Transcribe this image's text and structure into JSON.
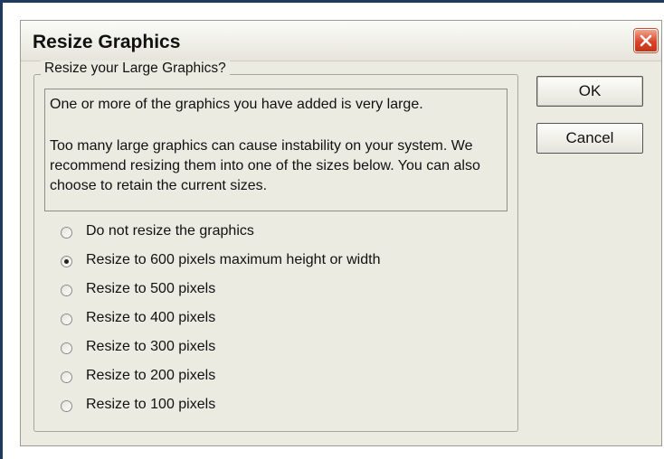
{
  "dialog": {
    "title": "Resize Graphics",
    "close_icon": "close-x-icon"
  },
  "group": {
    "legend": "Resize your Large Graphics?"
  },
  "message": {
    "line1": "One or more of the graphics you have added is very large.",
    "line2": "Too many large graphics can cause instability on your system. We recommend resizing them into one of the sizes below. You can also choose to retain the current sizes."
  },
  "options": [
    {
      "label": "Do not resize the graphics",
      "selected": false
    },
    {
      "label": "Resize to 600 pixels maximum height or width",
      "selected": true
    },
    {
      "label": "Resize to 500 pixels",
      "selected": false
    },
    {
      "label": "Resize to 400 pixels",
      "selected": false
    },
    {
      "label": "Resize to 300 pixels",
      "selected": false
    },
    {
      "label": "Resize to 200 pixels",
      "selected": false
    },
    {
      "label": "Resize to 100 pixels",
      "selected": false
    }
  ],
  "buttons": {
    "ok": "OK",
    "cancel": "Cancel"
  },
  "colors": {
    "dialog_bg": "#ecebe2",
    "close_button": "#d9452b"
  }
}
